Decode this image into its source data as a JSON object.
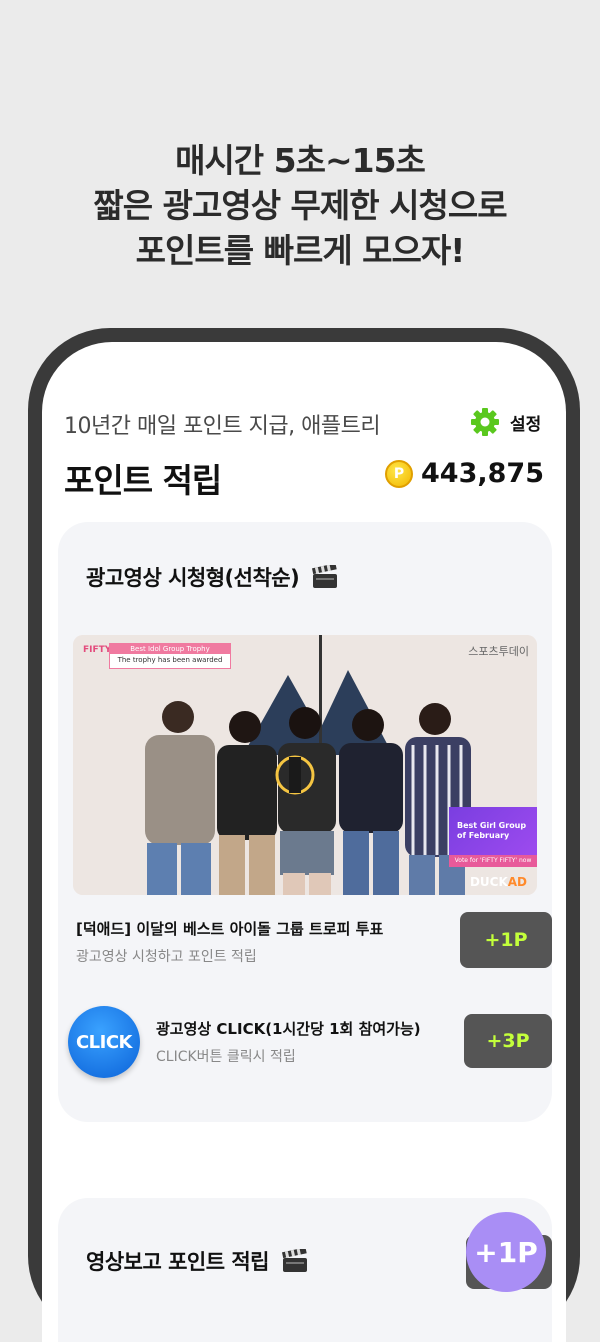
{
  "headline": {
    "line1": "매시간 5초~15초",
    "line2": "짧은 광고영상 무제한 시청으로",
    "line3": "포인트를 빠르게 모으자!"
  },
  "header": {
    "tagline": "10년간 매일 포인트 지급, 애플트리",
    "settings_label": "설정",
    "page_title": "포인트 적립",
    "points_balance": "443,875",
    "coin_symbol": "P"
  },
  "ad_section": {
    "title": "광고영상 시청형(선착순)",
    "thumbnail": {
      "badge_top": "Best Idol Group Trophy",
      "badge_bottom": "The trophy has been awarded",
      "watermark": "스포츠투데이",
      "ad_box_text": "Best Girl Group of February",
      "ad_footer": "Vote for 'FIFTY FIFTY' now",
      "brand_duck": "DUCK",
      "brand_ad": "AD"
    },
    "items": [
      {
        "title": "[덕애드] 이달의 베스트 아이돌 그룹 트로피 투표",
        "subtitle": "광고영상 시청하고 포인트 적립",
        "reward": "+1P"
      },
      {
        "icon_label": "CLICK",
        "title": "광고영상 CLICK(1시간당 1회 참여가능)",
        "subtitle": "CLICK버튼 클릭시 적립",
        "reward": "+3P"
      }
    ]
  },
  "video_section": {
    "title": "영상보고 포인트 적립"
  },
  "fab": {
    "label": "+1P"
  },
  "colors": {
    "accent_green": "#c3ff3b",
    "fab_purple": "#a98ef5",
    "button_gray": "#555555",
    "settings_green": "#5ac81e",
    "coin_gold": "#f2b600"
  }
}
